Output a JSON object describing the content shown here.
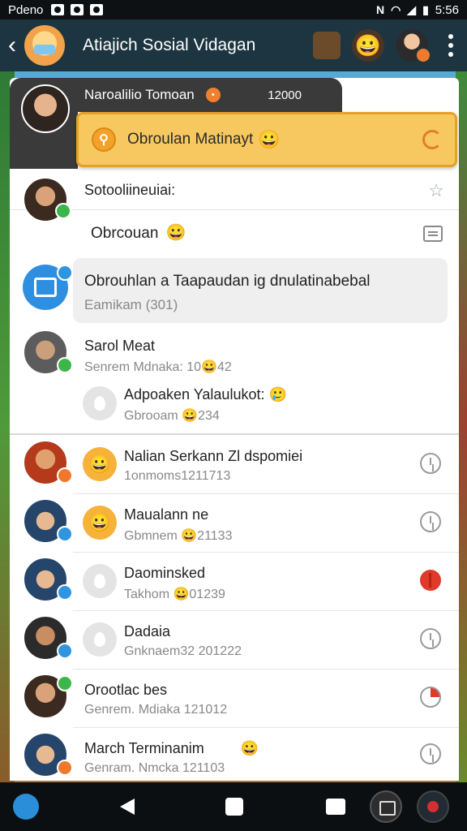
{
  "status_bar": {
    "carrier": "Pdeno",
    "time": "5:56"
  },
  "app_bar": {
    "title": "Atiajich Sosial Vidagan"
  },
  "header": {
    "name": "Naroalilio Tomoan",
    "count": "12000"
  },
  "promo": {
    "text": "Obroulan Matinayt",
    "emoji": "😀"
  },
  "section": {
    "title": "Sotooliineuiai:",
    "subtitle": "Obrcouan",
    "subtitle_emoji": "😀"
  },
  "highlight": {
    "title": "Obrouhlan a Taapaudan ig dnulatinabebal",
    "subtitle": "Eamikam (301)"
  },
  "items_top": [
    {
      "title": "Sarol Meat",
      "subtitle": "Senrem Mdnaka: 10😀42"
    },
    {
      "title": "Adpoaken Yalaulukot:",
      "title_emoji": "🥲",
      "subtitle": "Gbrooam 😀234"
    }
  ],
  "list": [
    {
      "title": "Nalian Serkann Zl dspomiei",
      "subtitle": "1onmoms1211713",
      "status": "clock"
    },
    {
      "title": "Maualann ne",
      "subtitle": "Gbmnem 😀21133",
      "status": "clock"
    },
    {
      "title": "Daominsked",
      "subtitle": "Takhom 😀01239",
      "status": "alert"
    },
    {
      "title": "Dadaia",
      "subtitle": "Gnknaem32 201222",
      "status": "clock"
    },
    {
      "title": "Orootlac bes",
      "subtitle": "Genrem. Mdiaka 121012",
      "status": "pie"
    },
    {
      "title": "March Terminanim",
      "title_emoji": "😀",
      "subtitle": "Genram. Nmcka 121103",
      "status": "clock"
    }
  ],
  "colors": {
    "app_bar": "#1c3540",
    "promo_bg": "#f7c860",
    "accent_blue": "#2e8fe0",
    "alert_red": "#e03a2a"
  }
}
